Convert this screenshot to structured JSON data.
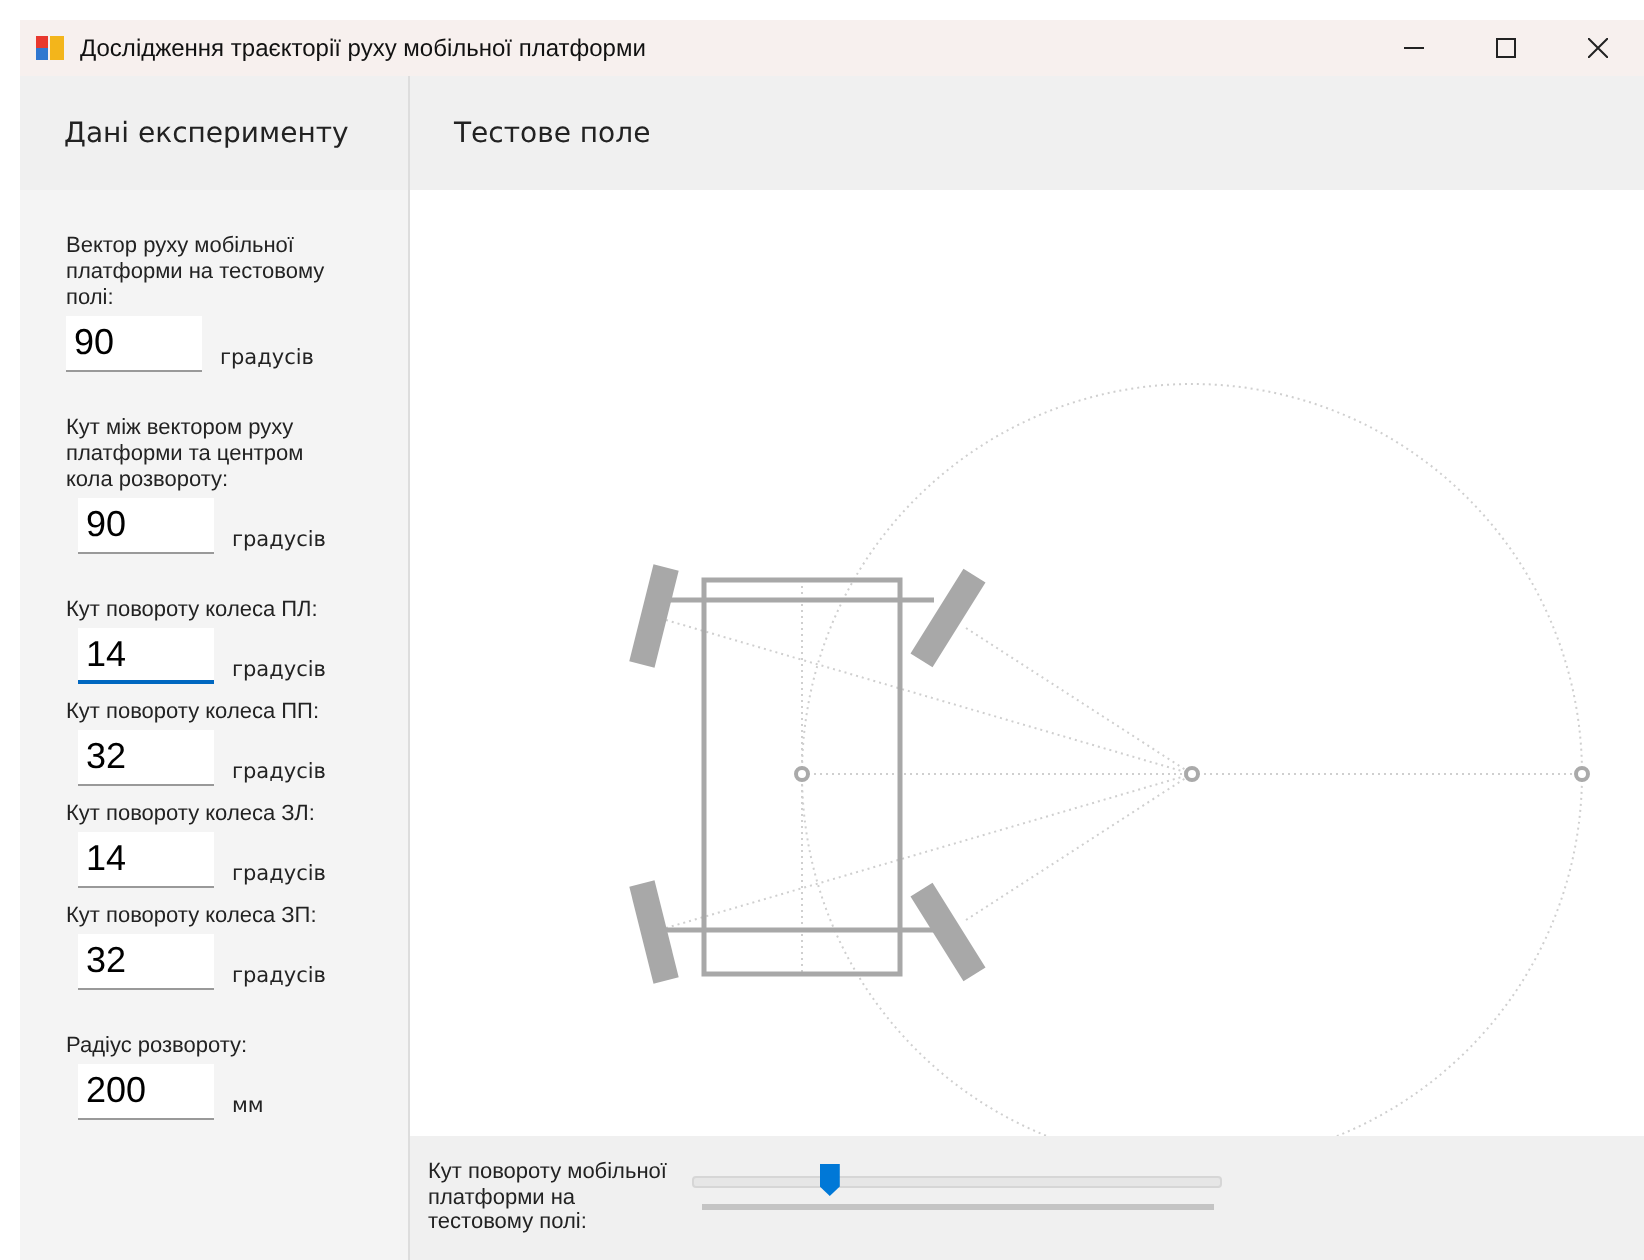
{
  "window": {
    "title": "Дослідження траєкторії руху мобільної платформи"
  },
  "left_panel": {
    "title": "Дані експерименту",
    "fields": [
      {
        "label": "Вектор руху мобільної платформи на тестовому полі:",
        "value": "90",
        "unit": "градусів",
        "focused": false
      },
      {
        "label": "Кут між вектором руху платформи та центром кола розвороту:",
        "value": "90",
        "unit": "градусів",
        "focused": false
      },
      {
        "label": "Кут повороту колеса ПЛ:",
        "value": "14",
        "unit": "градусів",
        "focused": true
      },
      {
        "label": "Кут повороту колеса ПП:",
        "value": "32",
        "unit": "градусів",
        "focused": false
      },
      {
        "label": "Кут повороту колеса ЗЛ:",
        "value": "14",
        "unit": "градусів",
        "focused": false
      },
      {
        "label": "Кут повороту колеса ЗП:",
        "value": "32",
        "unit": "градусів",
        "focused": false
      },
      {
        "label": "Радіус розвороту:",
        "value": "200",
        "unit": "мм",
        "focused": false
      }
    ]
  },
  "test_field": {
    "title": "Тестове поле"
  },
  "rotation_control": {
    "label": "Кут повороту мобільної платформи на тестовому полі:",
    "level": 0.26
  }
}
